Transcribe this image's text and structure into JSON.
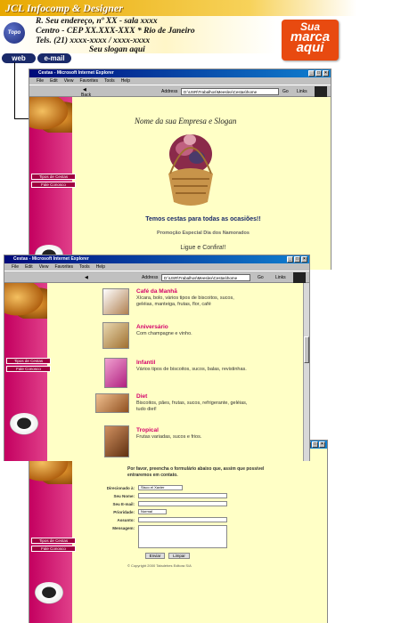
{
  "header": {
    "title": "JCL Infocomp & Designer",
    "topo": "Topo",
    "address_line1": "R. Seu endereço, nº XX - sala xxxx",
    "address_line2": "Centro - CEP XX.XXX-XXX * Rio de Janeiro",
    "phones": "Tels. (21) xxxx-xxxx / xxxx-xxxx",
    "slogan": "Seu slogan aqui",
    "brand_box": {
      "line1": "Sua",
      "line2": "marca",
      "line3": "aqui"
    },
    "web_button": "web",
    "email_button": "e-mail"
  },
  "browser": {
    "title": "Cestas - Microsoft Internet Explorer",
    "menu": [
      "File",
      "Edit",
      "View",
      "Favorites",
      "Tools",
      "Help"
    ],
    "back": "Back",
    "address_label": "Address",
    "address_value": "D:\\USR\\Trabalhos\\Meeslex\\Cestas\\home",
    "go": "Go",
    "links": "Links"
  },
  "sidebar": {
    "items": [
      "Tipos de Cestas",
      "Fale Conosco"
    ]
  },
  "home": {
    "arc_text": "Nome da sua Empresa e Slogan",
    "tagline": "Temos cestas para todas as ocasiões!!",
    "promo": "Promoção Especial Dia dos Namorados",
    "cta": "Ligue e Confira!!"
  },
  "products": [
    {
      "title": "Café da Manhã",
      "desc": "Xícara, bolo, vários tipos de biscoitos, sucos, geléias, manteiga, frutas, flor, café"
    },
    {
      "title": "Aniversário",
      "desc": "Com champagne e vinho."
    },
    {
      "title": "Infantil",
      "desc": "Vários tipos de biscoitos, sucos, balas, revistinhas."
    },
    {
      "title": "Diet",
      "desc": "Biscoitos, pães, frutas, sucos, refrigerante, geléias, tudo diet!"
    },
    {
      "title": "Tropical",
      "desc": "Frutas variadas, sucos e frios."
    }
  ],
  "form": {
    "intro": "Por favor, preencha o formulário abaixo que, assim que possível entraremos em contato.",
    "labels": {
      "to": "Direcionado à:",
      "name": "Seu Nome:",
      "email": "Seu E-mail:",
      "priority": "Prioridade:",
      "subject": "Assunto:",
      "message": "Mensagem:"
    },
    "to_value": "Sisco el Xavier",
    "priority_value": "Normal",
    "send": "Enviar",
    "clear": "Limpar",
    "copyright": "© Copyright 2000 Tabulehes Editora S/A"
  },
  "colors": {
    "accent": "#d4006a",
    "header_gold": "#e8a800",
    "brand_orange": "#e84a10",
    "page_bg": "#ffffc6"
  }
}
